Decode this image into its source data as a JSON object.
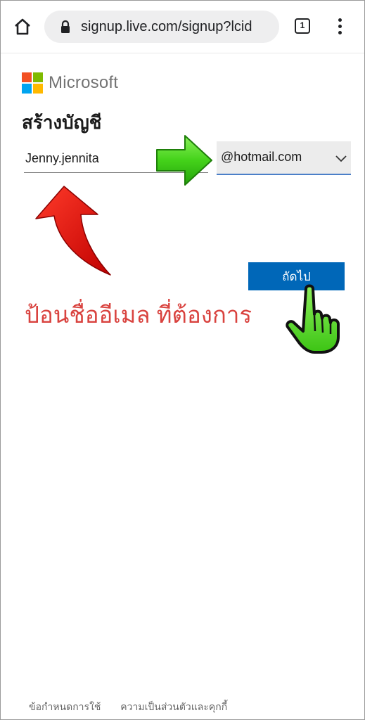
{
  "browser": {
    "url": "signup.live.com/signup?lcid",
    "tab_count": "1",
    "icons": [
      "home-icon",
      "lock-icon",
      "tab-switcher-icon",
      "more-menu-icon"
    ]
  },
  "page": {
    "brand": "Microsoft",
    "heading": "สร้างบัญชี",
    "email_value": "Jenny.jennita",
    "domain_value": "@hotmail.com",
    "next_label": "ถัดไป",
    "instruction": "ป้อนชื่ออีเมล ที่ต้องการ"
  },
  "footer": {
    "terms": "ข้อกำหนดการใช้",
    "privacy": "ความเป็นส่วนตัวและคุกกี้"
  },
  "colors": {
    "logo_red": "#f25022",
    "logo_green": "#7fba00",
    "logo_blue": "#00a4ef",
    "logo_yellow": "#ffb900",
    "primary_button": "#0067b8",
    "instruction_text": "#d9433f",
    "annotation_arrow_red": "#e10600",
    "annotation_arrow_green": "#44d21a"
  }
}
